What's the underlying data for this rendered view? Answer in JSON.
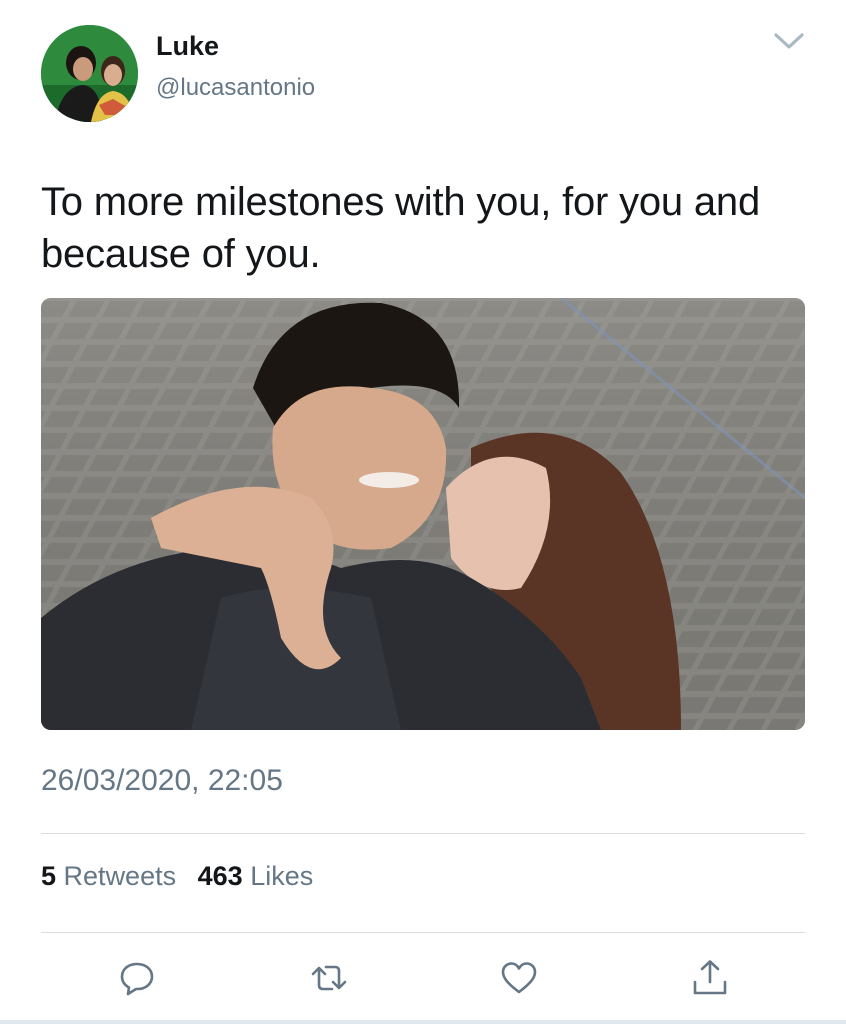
{
  "user": {
    "display_name": "Luke",
    "handle": "@lucasantonio",
    "avatar_icon": "profile-photo"
  },
  "tweet": {
    "text": "To more milestones with you, for you and because of you.",
    "timestamp": "26/03/2020, 22:05",
    "retweets_count": "5",
    "retweets_label": "Retweets",
    "likes_count": "463",
    "likes_label": "Likes"
  },
  "actions": {
    "reply_icon": "speech-bubble-icon",
    "retweet_icon": "retweet-arrows-icon",
    "like_icon": "heart-icon",
    "share_icon": "share-upload-icon"
  },
  "colors": {
    "primary_text": "#14171a",
    "secondary_text": "#657786",
    "divider": "#d8dde1",
    "icon": "#657786"
  }
}
